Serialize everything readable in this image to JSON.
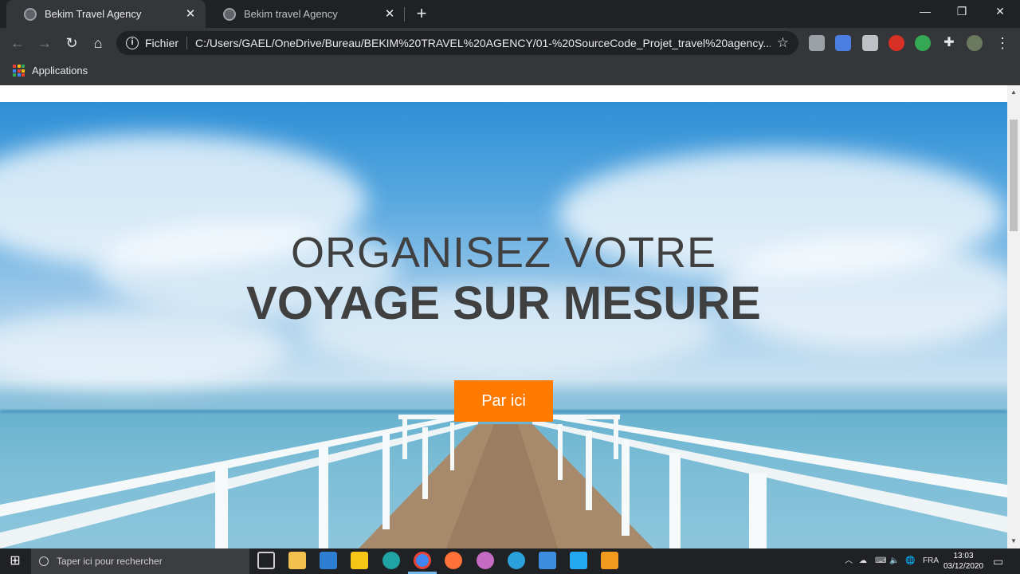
{
  "browser": {
    "tabs": [
      {
        "title": "Bekim Travel Agency",
        "active": true
      },
      {
        "title": "Bekim travel Agency",
        "active": false
      }
    ],
    "address": {
      "scheme": "Fichier",
      "url": "C:/Users/GAEL/OneDrive/Bureau/BEKIM%20TRAVEL%20AGENCY/01-%20SourceCode_Projet_travel%20agency..."
    },
    "bookmarks": {
      "apps_label": "Applications"
    }
  },
  "page": {
    "hero": {
      "line1": "ORGANISEZ VOTRE",
      "line2": "VOYAGE SUR MESURE",
      "cta_label": "Par ici"
    },
    "colors": {
      "cta": "#ff7b00",
      "hero_text": "#404040"
    }
  },
  "taskbar": {
    "search_placeholder": "Taper ici pour rechercher",
    "language": "FRA",
    "time": "13:03",
    "date": "03/12/2020"
  }
}
